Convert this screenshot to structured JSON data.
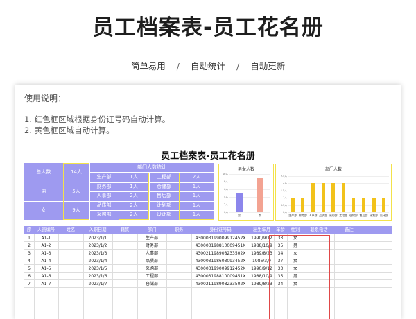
{
  "title": "员工档案表-员工花名册",
  "subtitle": {
    "items": [
      "简单易用",
      "自动统计",
      "自动更新"
    ],
    "separator": "/"
  },
  "instructions": {
    "title": "使用说明：",
    "lines": [
      "1. 红色框区域根据身份证号码自动计算。",
      "2. 黄色框区域自动计算。"
    ]
  },
  "sheet_title": "员工档案表-员工花名册",
  "summary": {
    "total_label": "总人数",
    "total_value": "14人",
    "male_label": "男",
    "male_value": "5人",
    "female_label": "女",
    "female_value": "9人",
    "dept_header": "部门人数统计",
    "depts": [
      {
        "name": "生产部",
        "count": "1人"
      },
      {
        "name": "工程部",
        "count": "2人"
      },
      {
        "name": "财务部",
        "count": "1人"
      },
      {
        "name": "仓储部",
        "count": "1人"
      },
      {
        "name": "人事部",
        "count": "2人"
      },
      {
        "name": "售后部",
        "count": "1人"
      },
      {
        "name": "品质部",
        "count": "2人"
      },
      {
        "name": "计划部",
        "count": "1人"
      },
      {
        "name": "采购部",
        "count": "2人"
      },
      {
        "name": "设计部",
        "count": "1人"
      }
    ]
  },
  "chart_data": [
    {
      "type": "bar",
      "title": "男女人数",
      "categories": [
        "男",
        "女"
      ],
      "values": [
        5,
        9
      ],
      "ylim": [
        0,
        10
      ],
      "yticks": [
        "10人",
        "8人",
        "6人",
        "4人",
        "2人",
        "0人"
      ],
      "colors": [
        "#8c86ec",
        "#f3a392"
      ]
    },
    {
      "type": "bar",
      "title": "部门人数",
      "categories": [
        "生产部",
        "财务部",
        "人事部",
        "品质部",
        "采购部",
        "工程部",
        "仓储部",
        "售后部",
        "计划部",
        "设计部"
      ],
      "values": [
        1,
        1,
        2,
        2,
        2,
        2,
        1,
        1,
        1,
        1
      ],
      "ylim": [
        0,
        2.5
      ],
      "yticks": [
        "2.5人",
        "2人",
        "1.5人",
        "1人",
        "0.5人",
        "0人"
      ],
      "colors": [
        "#f2c21b"
      ]
    }
  ],
  "table": {
    "headers": [
      "序",
      "人员编号",
      "姓名",
      "入职日期",
      "籍贯",
      "部门",
      "职务",
      "身份证号码",
      "出生年月",
      "年龄",
      "性别",
      "联系电话",
      "备注"
    ],
    "rows": [
      [
        "1",
        "A1-1",
        "",
        "2023/1/1",
        "",
        "生产部",
        "",
        "430003199009912452X",
        "1990/9/12",
        "33",
        "女",
        "",
        ""
      ],
      [
        "2",
        "A1-2",
        "",
        "2023/1/2",
        "",
        "财务部",
        "",
        "430003198810009451X",
        "1988/10/9",
        "35",
        "男",
        "",
        ""
      ],
      [
        "3",
        "A1-3",
        "",
        "2023/1/3",
        "",
        "人事部",
        "",
        "430021198908233502X",
        "1989/8/23",
        "34",
        "女",
        "",
        ""
      ],
      [
        "4",
        "A1-4",
        "",
        "2023/1/4",
        "",
        "品质部",
        "",
        "430003198603093452X",
        "1986/3/9",
        "37",
        "女",
        "",
        ""
      ],
      [
        "5",
        "A1-5",
        "",
        "2023/1/5",
        "",
        "采购部",
        "",
        "430003199009912452X",
        "1990/9/12",
        "33",
        "女",
        "",
        ""
      ],
      [
        "6",
        "A1-6",
        "",
        "2023/1/6",
        "",
        "工程部",
        "",
        "430003198810009451X",
        "1988/10/9",
        "35",
        "男",
        "",
        ""
      ],
      [
        "7",
        "A1-7",
        "",
        "2023/1/7",
        "",
        "仓储部",
        "",
        "430021198908233502X",
        "1989/8/23",
        "34",
        "女",
        "",
        ""
      ]
    ]
  }
}
